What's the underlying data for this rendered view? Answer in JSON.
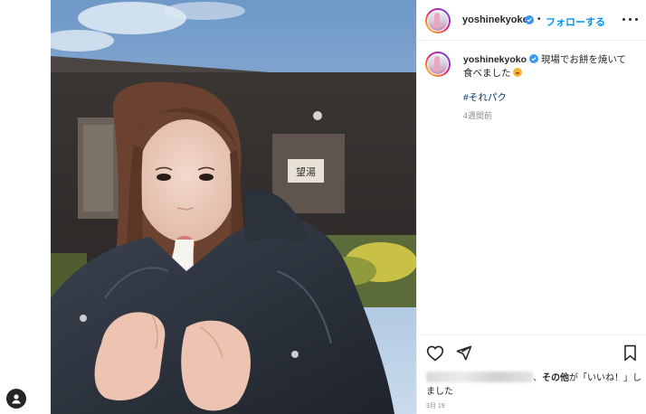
{
  "post": {
    "username": "yoshinekyoko",
    "separator": "•",
    "follow_label": "フォローする",
    "caption_text": "現場でお餅を焼いて食べました",
    "hashtag": "#それパク",
    "time_ago": "4週間前",
    "likes_suffix_1": "、",
    "likes_others": "その他",
    "likes_suffix_2": "が「いいね！」しました",
    "date": "3月 19"
  },
  "colors": {
    "accent": "#0095f6",
    "hashtag": "#00376b",
    "muted": "#8e8e8e",
    "verified": "#3897f0"
  },
  "icons": {
    "more": "more-horizontal-icon",
    "like": "heart-icon",
    "share": "send-icon",
    "save": "bookmark-icon",
    "verified": "verified-badge-icon",
    "profile": "person-icon"
  }
}
